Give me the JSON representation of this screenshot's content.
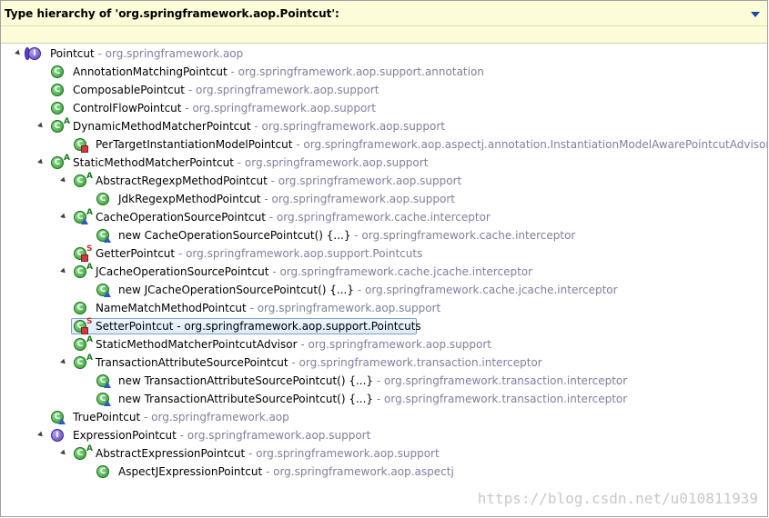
{
  "title": "Type hierarchy of 'org.springframework.aop.Pointcut':",
  "watermark": "https://blog.csdn.net/u010811939",
  "rows": [
    {
      "name": "Pointcut",
      "pkg": " - org.springframework.aop",
      "icon": "interface",
      "twisty": true
    },
    {
      "name": "AnnotationMatchingPointcut",
      "pkg": " - org.springframework.aop.support.annotation",
      "icon": "class"
    },
    {
      "name": "ComposablePointcut",
      "pkg": " - org.springframework.aop.support",
      "icon": "class"
    },
    {
      "name": "ControlFlowPointcut",
      "pkg": " - org.springframework.aop.support",
      "icon": "class"
    },
    {
      "name": "DynamicMethodMatcherPointcut",
      "pkg": " - org.springframework.aop.support",
      "icon": "class",
      "mark": "A",
      "twisty": true
    },
    {
      "name": "PerTargetInstantiationModelPointcut",
      "pkg": " - org.springframework.aop.aspectj.annotation.InstantiationModelAwarePointcutAdvisorIm",
      "icon": "class",
      "overlay": "red"
    },
    {
      "name": "StaticMethodMatcherPointcut",
      "pkg": " - org.springframework.aop.support",
      "icon": "class",
      "mark": "A",
      "twisty": true
    },
    {
      "name": "AbstractRegexpMethodPointcut",
      "pkg": " - org.springframework.aop.support",
      "icon": "class",
      "mark": "A",
      "twisty": true
    },
    {
      "name": "JdkRegexpMethodPointcut",
      "pkg": " - org.springframework.aop.support",
      "icon": "class"
    },
    {
      "name": "CacheOperationSourcePointcut",
      "pkg": " - org.springframework.cache.interceptor",
      "icon": "class",
      "mark": "A",
      "overlay": "blue",
      "twisty": true
    },
    {
      "name": "new CacheOperationSourcePointcut() {...}",
      "pkg": " - org.springframework.cache.interceptor",
      "icon": "class",
      "overlay": "blue"
    },
    {
      "name": "GetterPointcut",
      "pkg": " - org.springframework.aop.support.Pointcuts",
      "icon": "class",
      "mark": "S",
      "overlay": "red"
    },
    {
      "name": "JCacheOperationSourcePointcut",
      "pkg": " - org.springframework.cache.jcache.interceptor",
      "icon": "class",
      "mark": "A",
      "twisty": true
    },
    {
      "name": "new JCacheOperationSourcePointcut() {...}",
      "pkg": " - org.springframework.cache.jcache.interceptor",
      "icon": "class",
      "overlay": "blue"
    },
    {
      "name": "NameMatchMethodPointcut",
      "pkg": " - org.springframework.aop.support",
      "icon": "class"
    },
    {
      "name": "SetterPointcut",
      "pkg": " - org.springframework.aop.support.Pointcuts",
      "icon": "class",
      "mark": "S",
      "overlay": "red",
      "selected": true
    },
    {
      "name": "StaticMethodMatcherPointcutAdvisor",
      "pkg": " - org.springframework.aop.support",
      "icon": "class",
      "mark": "A"
    },
    {
      "name": "TransactionAttributeSourcePointcut",
      "pkg": " - org.springframework.transaction.interceptor",
      "icon": "class",
      "mark": "A",
      "twisty": true
    },
    {
      "name": "new TransactionAttributeSourcePointcut() {...}",
      "pkg": " - org.springframework.transaction.interceptor",
      "icon": "class",
      "overlay": "blue"
    },
    {
      "name": "new TransactionAttributeSourcePointcut() {...}",
      "pkg": " - org.springframework.transaction.interceptor",
      "icon": "class",
      "overlay": "blue"
    },
    {
      "name": "TruePointcut",
      "pkg": " - org.springframework.aop",
      "icon": "class",
      "overlay": "blue"
    },
    {
      "name": "ExpressionPointcut",
      "pkg": " - org.springframework.aop.support",
      "icon": "interface",
      "twisty": true
    },
    {
      "name": "AbstractExpressionPointcut",
      "pkg": " - org.springframework.aop.support",
      "icon": "class",
      "mark": "A",
      "twisty": true
    },
    {
      "name": "AspectJExpressionPointcut",
      "pkg": " - org.springframework.aop.aspectj",
      "icon": "class"
    }
  ]
}
